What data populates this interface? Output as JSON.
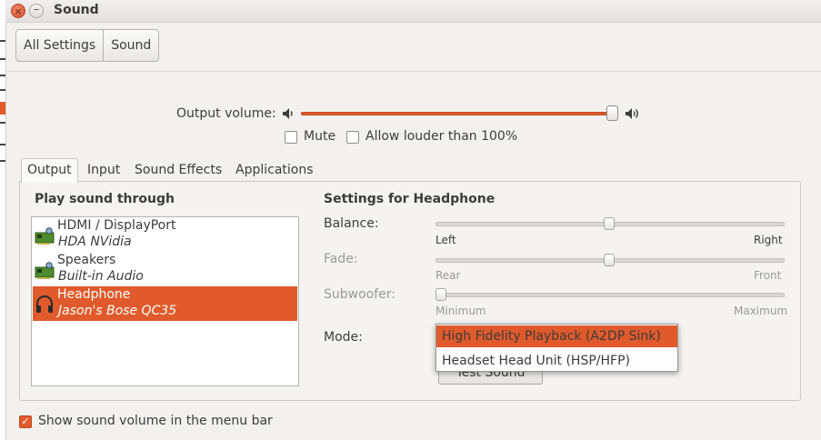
{
  "window": {
    "title": "Sound",
    "close_glyph": "×",
    "minimize_glyph": "–"
  },
  "breadcrumb": {
    "items": [
      "All Settings",
      "Sound"
    ]
  },
  "output_volume": {
    "label": "Output volume:",
    "level_percent": 100,
    "mute_label": "Mute",
    "mute_checked": false,
    "louder_label": "Allow louder than 100%",
    "louder_checked": false
  },
  "tabs": [
    {
      "label": "Output",
      "active": true
    },
    {
      "label": "Input",
      "active": false
    },
    {
      "label": "Sound Effects",
      "active": false
    },
    {
      "label": "Applications",
      "active": false
    }
  ],
  "play_through": {
    "title": "Play sound through",
    "devices": [
      {
        "name": "HDMI / DisplayPort",
        "description": "HDA NVidia",
        "icon": "sound-card-icon",
        "selected": false
      },
      {
        "name": "Speakers",
        "description": "Built-in Audio",
        "icon": "sound-card-icon",
        "selected": false
      },
      {
        "name": "Headphone",
        "description": "Jason's Bose QC35",
        "icon": "headphones-icon",
        "selected": true
      }
    ]
  },
  "settings": {
    "title": "Settings for Headphone",
    "balance": {
      "label": "Balance:",
      "min_label": "Left",
      "max_label": "Right",
      "value_fraction": 0.5
    },
    "fade": {
      "label": "Fade:",
      "min_label": "Rear",
      "max_label": "Front",
      "value_fraction": 0.5
    },
    "subwoofer": {
      "label": "Subwoofer:",
      "min_label": "Minimum",
      "max_label": "Maximum",
      "value_fraction": 0.0
    },
    "mode": {
      "label": "Mode:",
      "options": [
        "High Fidelity Playback (A2DP Sink)",
        "Headset Head Unit (HSP/HFP)"
      ],
      "selected": "High Fidelity Playback (A2DP Sink)"
    },
    "test_button_label": "Test Sound"
  },
  "menu_bar_option": {
    "label": "Show sound volume in the menu bar",
    "checked": true
  },
  "colors": {
    "accent": "#e05a2b",
    "window_bg": "#f2f1f0",
    "text": "#3c3c3c"
  }
}
